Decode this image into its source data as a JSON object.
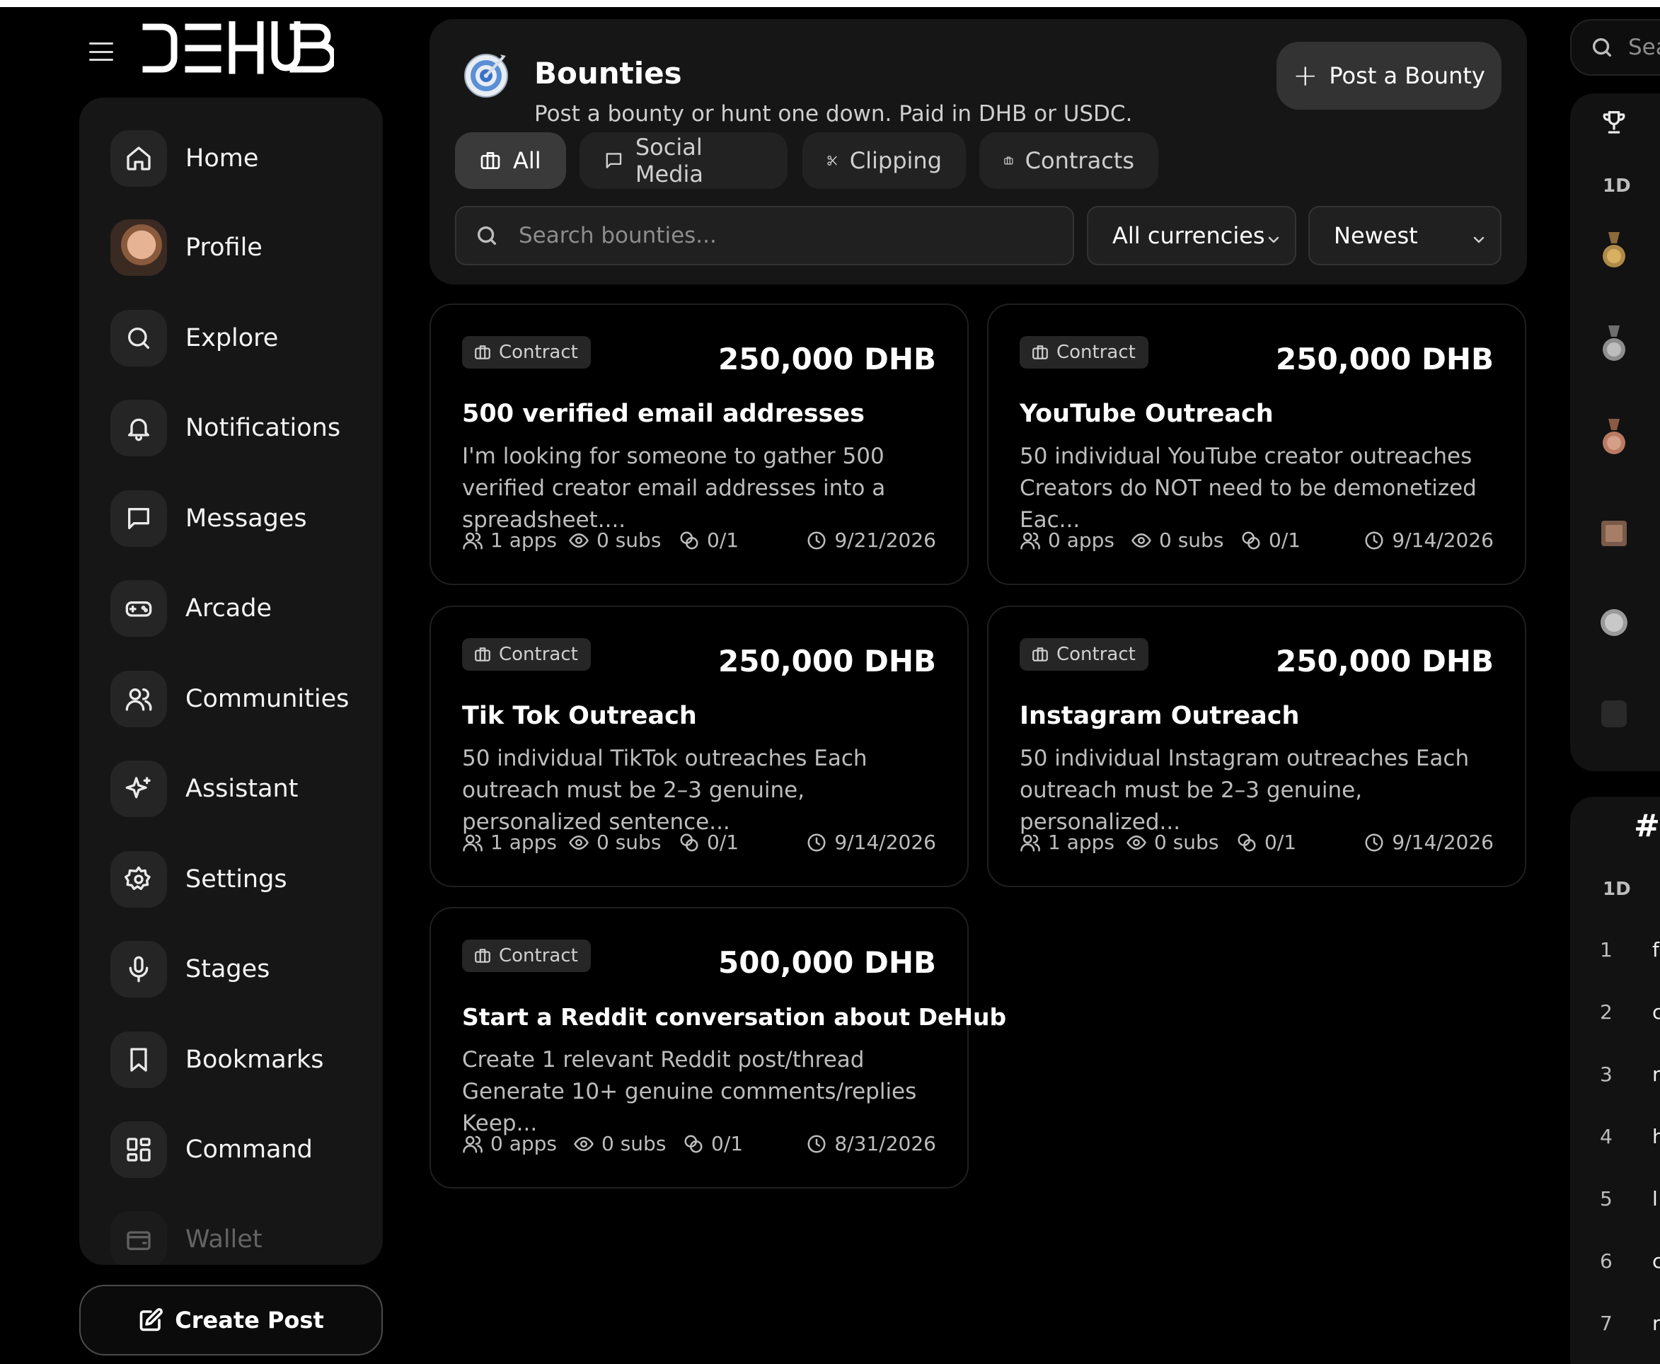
{
  "app": {
    "brand": "DEHUB",
    "colors": {
      "background": "#000000",
      "panel": "#161616",
      "accent_text": "#ffffff",
      "muted_text": "#bdbdbd"
    }
  },
  "sidebar": {
    "items": [
      {
        "label": "Home",
        "icon": "home-icon"
      },
      {
        "label": "Profile",
        "icon": "avatar"
      },
      {
        "label": "Explore",
        "icon": "search-icon"
      },
      {
        "label": "Notifications",
        "icon": "bell-icon"
      },
      {
        "label": "Messages",
        "icon": "message-icon"
      },
      {
        "label": "Arcade",
        "icon": "gamepad-icon"
      },
      {
        "label": "Communities",
        "icon": "users-icon"
      },
      {
        "label": "Assistant",
        "icon": "sparkle-icon"
      },
      {
        "label": "Settings",
        "icon": "gear-icon"
      },
      {
        "label": "Stages",
        "icon": "microphone-icon"
      },
      {
        "label": "Bookmarks",
        "icon": "bookmark-icon"
      },
      {
        "label": "Command",
        "icon": "grid-icon"
      },
      {
        "label": "Wallet",
        "icon": "wallet-icon"
      }
    ],
    "create_post_label": "Create Post"
  },
  "header": {
    "title": "Bounties",
    "subtitle": "Post a bounty or hunt one down. Paid in DHB or USDC.",
    "post_button_label": "Post a Bounty"
  },
  "tabs": [
    {
      "label": "All",
      "icon": "briefcase-icon",
      "active": true
    },
    {
      "label": "Social Media",
      "icon": "message-icon",
      "active": false
    },
    {
      "label": "Clipping",
      "icon": "scissors-icon",
      "active": false
    },
    {
      "label": "Contracts",
      "icon": "briefcase-icon",
      "active": false
    }
  ],
  "filters": {
    "search_placeholder": "Search bounties...",
    "currency": "All currencies",
    "sort": "Newest"
  },
  "bounties": [
    {
      "badge": "Contract",
      "amount": "250,000 DHB",
      "title": "500 verified email addresses",
      "description": "I'm looking for someone to gather 500 verified creator email addresses into a spreadsheet....",
      "apps": "1 apps",
      "subs": "0 subs",
      "slots": "0/1",
      "date": "9/21/2026"
    },
    {
      "badge": "Contract",
      "amount": "250,000 DHB",
      "title": "YouTube Outreach",
      "description": "50 individual YouTube creator outreaches Creators do NOT need to be demonetized Eac...",
      "apps": "0 apps",
      "subs": "0 subs",
      "slots": "0/1",
      "date": "9/14/2026"
    },
    {
      "badge": "Contract",
      "amount": "250,000 DHB",
      "title": "Tik Tok Outreach",
      "description": "50 individual TikTok outreaches Each outreach must be 2–3 genuine, personalized sentence...",
      "apps": "1 apps",
      "subs": "0 subs",
      "slots": "0/1",
      "date": "9/14/2026"
    },
    {
      "badge": "Contract",
      "amount": "250,000 DHB",
      "title": "Instagram Outreach",
      "description": "50 individual Instagram outreaches Each outreach must be 2–3 genuine, personalized...",
      "apps": "1 apps",
      "subs": "0 subs",
      "slots": "0/1",
      "date": "9/14/2026"
    },
    {
      "badge": "Contract",
      "amount": "500,000 DHB",
      "title": "Start a Reddit conversation about DeHub",
      "description": "Create 1 relevant Reddit post/thread Generate 10+ genuine comments/replies Keep...",
      "apps": "0 apps",
      "subs": "0 subs",
      "slots": "0/1",
      "date": "8/31/2026"
    }
  ],
  "right_column": {
    "search_placeholder": "Sea",
    "leaderboard_period": "1D",
    "medals": [
      "gold-medal-icon",
      "silver-medal-icon",
      "bronze-medal-icon",
      "bronze-badge-icon",
      "silver-coin-icon",
      "black-badge-icon"
    ],
    "hashtags_symbol": "#",
    "hashtags_period": "1D",
    "ranks": [
      {
        "num": "1",
        "name": "f"
      },
      {
        "num": "2",
        "name": "c"
      },
      {
        "num": "3",
        "name": "r"
      },
      {
        "num": "4",
        "name": "h"
      },
      {
        "num": "5",
        "name": "l"
      },
      {
        "num": "6",
        "name": "c"
      },
      {
        "num": "7",
        "name": "r"
      }
    ]
  }
}
